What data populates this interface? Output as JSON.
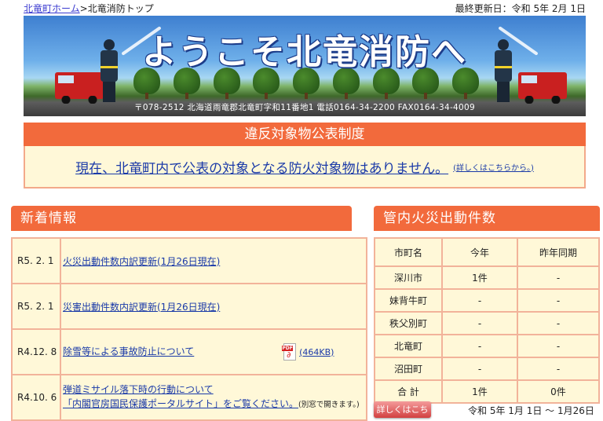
{
  "breadcrumb": {
    "home_link": "北竜町ホーム",
    "separator": ">",
    "current": "北竜消防トップ"
  },
  "last_updated": "最終更新日：令和 5年 2月 1日",
  "banner": {
    "title": "ようこそ北竜消防へ",
    "address": "〒078-2512 北海道雨竜郡北竜町字和11番地1 電話0164-34-2200 FAX0164-34-4009"
  },
  "notice": {
    "header": "違反対象物公表制度",
    "message": "現在、北竜町内で公表の対象となる防火対象物はありません。",
    "detail_link": "(詳しくはこちらから。)"
  },
  "news": {
    "header": "新着情報",
    "items": [
      {
        "date": "R5. 2. 1",
        "title": "火災出動件数内訳更新(1月26日現在)"
      },
      {
        "date": "R5. 2. 1",
        "title": "災害出動件数内訳更新(1月26日現在)"
      },
      {
        "date": "R4.12. 8",
        "title": "除雪等による事故防止について",
        "attachment_size": "(464KB)",
        "attachment_icon": "pdf-icon"
      },
      {
        "date": "R4.10. 6",
        "title": "弾道ミサイル落下時の行動について",
        "subtitle": "「内閣官房国民保護ポータルサイト」をご覧ください。",
        "note": "(別窓で開きます。)"
      }
    ]
  },
  "fire_counts": {
    "header": "管内火災出動件数",
    "columns": [
      "市町名",
      "今年",
      "昨年同期"
    ],
    "rows": [
      [
        "深川市",
        "1件",
        "-"
      ],
      [
        "妹背牛町",
        "-",
        "-"
      ],
      [
        "秩父別町",
        "-",
        "-"
      ],
      [
        "北竜町",
        "-",
        "-"
      ],
      [
        "沼田町",
        "-",
        "-"
      ],
      [
        "合 計",
        "1件",
        "0件"
      ]
    ],
    "detail_button": "詳しくはこちら",
    "period": "令和 5年 1月 1日 〜 1月26日"
  },
  "colors": {
    "accent_orange": "#f26a3c",
    "panel_cream": "#fff8d8",
    "link_blue": "#1a3aa8"
  }
}
